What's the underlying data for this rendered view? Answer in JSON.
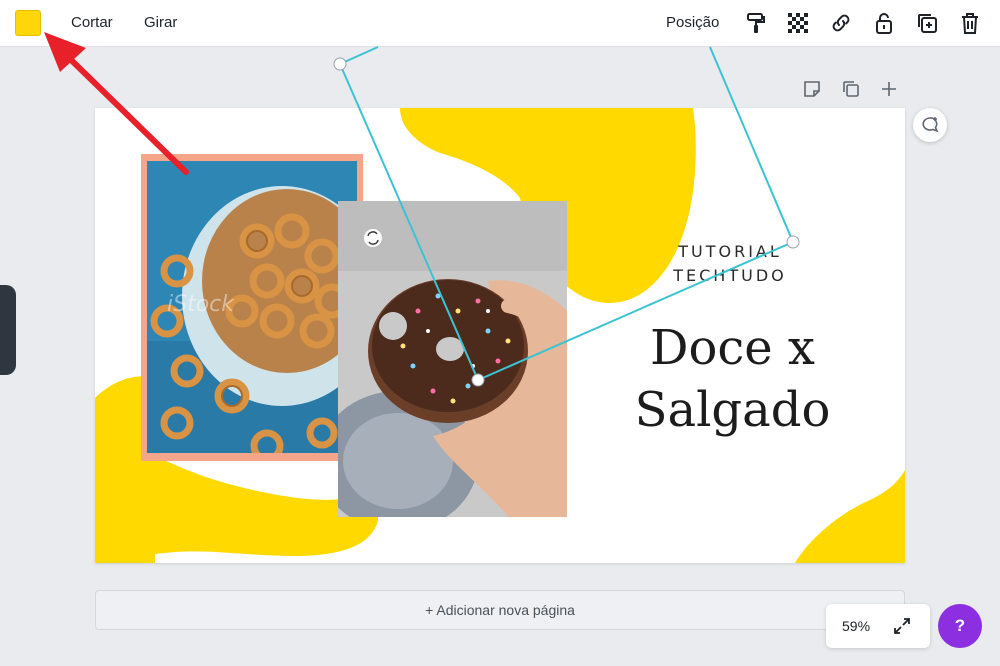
{
  "toolbar": {
    "color_swatch": "#FFD60A",
    "crop_label": "Cortar",
    "flip_label": "Girar",
    "position_label": "Posição",
    "icons": [
      "paint-roller-icon",
      "transparency-icon",
      "link-icon",
      "lock-icon",
      "duplicate-icon",
      "trash-icon"
    ]
  },
  "page_controls": {
    "icons": [
      "notes-icon",
      "copy-page-icon",
      "add-page-icon"
    ]
  },
  "design": {
    "tutorial_line1": "TUTORIAL",
    "tutorial_line2": "TECHTUDO",
    "headline_line1": "Doce x",
    "headline_line2": "Salgado",
    "accent_color": "#FFD900",
    "frame_color": "#F4A58A",
    "watermark": "iStock",
    "images": [
      "pretzel-bowl-photo",
      "donut-photo"
    ]
  },
  "selection": {
    "handle_color": "#3CC3D3"
  },
  "annotation": {
    "arrow_color": "#E8202A"
  },
  "footer": {
    "add_page_label": "+ Adicionar nova página",
    "zoom_label": "59%",
    "help_label": "?"
  }
}
